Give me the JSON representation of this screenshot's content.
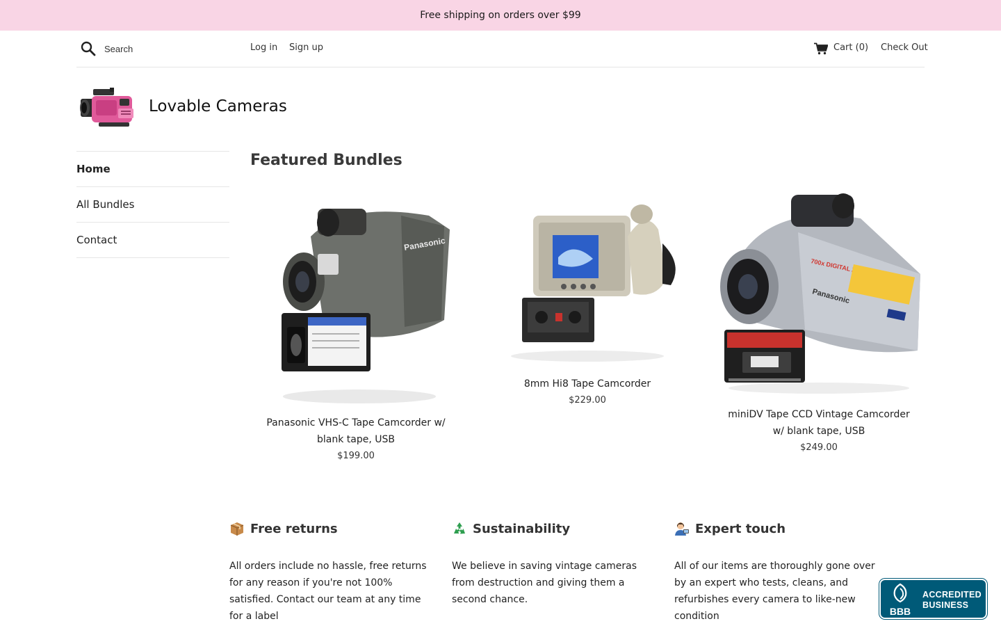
{
  "announcement": {
    "text": "Free shipping on orders over $99"
  },
  "header": {
    "search_placeholder": "Search",
    "login_label": "Log in",
    "signup_label": "Sign up",
    "cart_label": "Cart (0)",
    "checkout_label": "Check Out",
    "search_icon": "search-icon",
    "cart_icon": "cart-icon"
  },
  "brand": {
    "name": "Lovable Cameras",
    "logo_icon": "camcorder-logo",
    "accent_color": "#e05a9a"
  },
  "sidebar": {
    "items": [
      {
        "label": "Home",
        "active": true
      },
      {
        "label": "All Bundles",
        "active": false
      },
      {
        "label": "Contact",
        "active": false
      }
    ]
  },
  "featured": {
    "title": "Featured Bundles",
    "products": [
      {
        "name": "Panasonic VHS-C Tape Camcorder w/ blank tape, USB",
        "price": "$199.00"
      },
      {
        "name": "8mm Hi8 Tape Camcorder",
        "price": "$229.00"
      },
      {
        "name": "miniDV Tape CCD Vintage Camcorder w/ blank tape, USB",
        "price": "$249.00"
      }
    ]
  },
  "features": [
    {
      "icon": "package-icon",
      "title": "Free returns",
      "text": "All orders include no hassle, free returns for any reason if you're not 100% satisfied. Contact our team at any time for a label"
    },
    {
      "icon": "recycle-icon",
      "title": "Sustainability",
      "text": "We believe in saving vintage cameras from destruction and giving them a second chance."
    },
    {
      "icon": "technician-icon",
      "title": "Expert touch",
      "text": "All of our items are thoroughly gone over by an expert who tests, cleans, and refurbishes every camera to like-new condition"
    }
  ],
  "badge": {
    "line1": "ACCREDITED",
    "line2": "BUSINESS",
    "logo_text": "BBB",
    "color": "#005a78"
  },
  "colors": {
    "announcement_bg": "#f9d5e5",
    "text": "#222222"
  }
}
